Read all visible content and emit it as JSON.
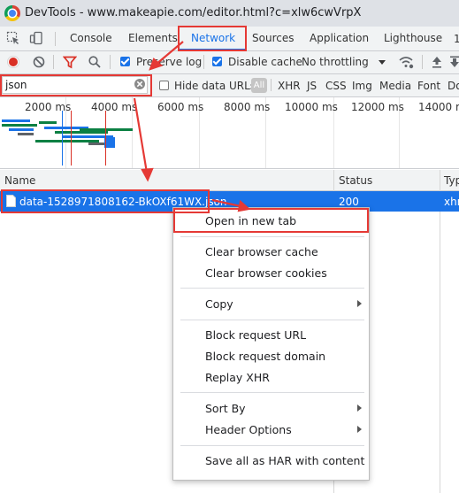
{
  "window": {
    "title": "DevTools - www.makeapie.com/editor.html?c=xlw6cwVrpX"
  },
  "tabs": [
    {
      "label": "Console"
    },
    {
      "label": "Elements"
    },
    {
      "label": "Network"
    },
    {
      "label": "Sources"
    },
    {
      "label": "Application"
    },
    {
      "label": "Lighthouse"
    }
  ],
  "toolbar": {
    "preserve_log": "Preserve log",
    "disable_cache": "Disable cache",
    "throttling": "No throttling"
  },
  "filter": {
    "value": "json",
    "hide_data_urls": "Hide data URLs",
    "all": "All",
    "types": [
      "XHR",
      "JS",
      "CSS",
      "Img",
      "Media",
      "Font",
      "Do"
    ]
  },
  "timeline": {
    "ticks": [
      "2000 ms",
      "4000 ms",
      "6000 ms",
      "8000 ms",
      "10000 ms",
      "12000 ms",
      "14000 m"
    ]
  },
  "table": {
    "columns": {
      "name": "Name",
      "status": "Status",
      "type": "Typ"
    },
    "rows": [
      {
        "name": "data-1528971808162-BkOXf61WX.json",
        "status": "200",
        "type": "xhr"
      }
    ]
  },
  "context_menu": {
    "open_new_tab": "Open in new tab",
    "clear_cache": "Clear browser cache",
    "clear_cookies": "Clear browser cookies",
    "copy": "Copy",
    "block_url": "Block request URL",
    "block_domain": "Block request domain",
    "replay_xhr": "Replay XHR",
    "sort_by": "Sort By",
    "header_options": "Header Options",
    "save_har": "Save all as HAR with content"
  },
  "colors": {
    "accent": "#1a73e8",
    "annotation": "#e53935",
    "record": "#d93025"
  }
}
